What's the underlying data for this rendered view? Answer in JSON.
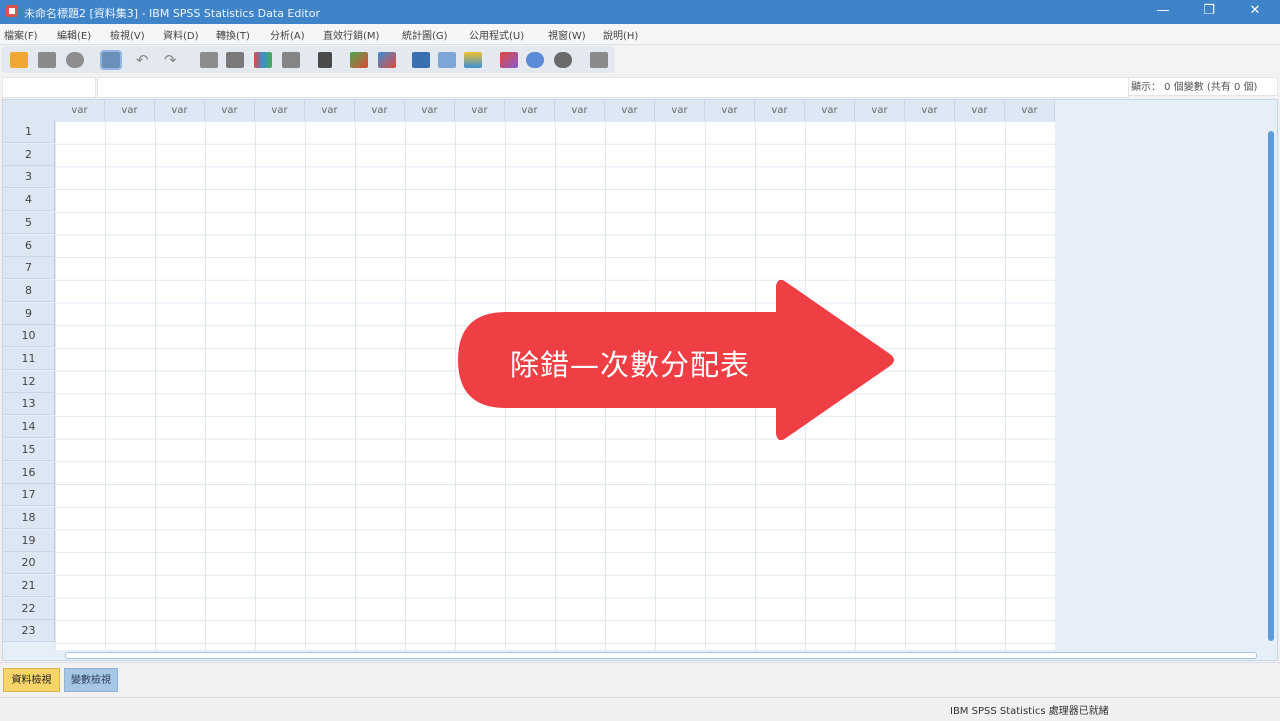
{
  "window": {
    "title": "未命名標題2 [資料集3] - IBM SPSS Statistics Data Editor",
    "minimize_glyph": "—",
    "maximize_glyph": "❐",
    "close_glyph": "✕",
    "titlebar_color": "#3f84c9"
  },
  "menu": {
    "items": [
      {
        "label": "檔案(F)"
      },
      {
        "label": "編輯(E)"
      },
      {
        "label": "檢視(V)"
      },
      {
        "label": "資料(D)"
      },
      {
        "label": "轉換(T)"
      },
      {
        "label": "分析(A)"
      },
      {
        "label": "直效行銷(M)"
      },
      {
        "label": "統計圖(G)"
      },
      {
        "label": "公用程式(U)"
      },
      {
        "label": "視窗(W)"
      },
      {
        "label": "說明(H)"
      }
    ]
  },
  "toolbar": {
    "icons": [
      "open-icon",
      "save-icon",
      "print-icon",
      "dialog-recall-icon",
      "undo-icon",
      "redo-icon",
      "goto-case-icon",
      "goto-variable-icon",
      "variables-icon",
      "run-descriptives-icon",
      "find-icon",
      "insert-cases-icon",
      "insert-variable-icon",
      "split-file-icon",
      "weight-cases-icon",
      "select-cases-icon",
      "value-labels-icon",
      "use-sets-icon",
      "show-all-variables-icon",
      "spell-check-icon"
    ]
  },
  "editor": {
    "info": "顯示： 0 個變數 (共有 0 個)"
  },
  "grid": {
    "column_label": "var",
    "rows": [
      "1",
      "2",
      "3",
      "4",
      "5",
      "6",
      "7",
      "8",
      "9",
      "10",
      "11",
      "12",
      "13",
      "14",
      "15",
      "16",
      "17",
      "18",
      "19",
      "20",
      "21",
      "22",
      "23"
    ]
  },
  "tabs": {
    "data_view": "資料檢視",
    "variable_view": "變數檢視"
  },
  "status": {
    "text": "IBM SPSS Statistics 處理器已就緒"
  },
  "callout": {
    "text": "除錯—次數分配表",
    "color": "#ef3f45"
  }
}
